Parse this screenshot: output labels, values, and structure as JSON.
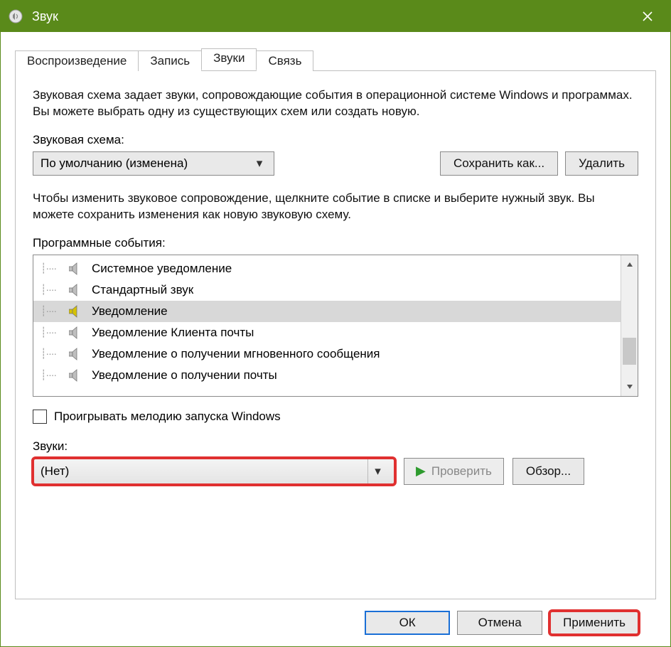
{
  "title": "Звук",
  "tabs": [
    "Воспроизведение",
    "Запись",
    "Звуки",
    "Связь"
  ],
  "active_tab": 2,
  "description": "Звуковая схема задает звуки, сопровождающие события в операционной системе Windows и программах. Вы можете выбрать одну из существующих схем или создать новую.",
  "scheme_label": "Звуковая схема:",
  "scheme_dropdown": "По умолчанию (изменена)",
  "save_as_btn": "Сохранить как...",
  "delete_btn": "Удалить",
  "events_desc": "Чтобы изменить звуковое сопровождение, щелкните событие в списке и выберите нужный звук. Вы можете сохранить изменения как новую звуковую схему.",
  "events_label": "Программные события:",
  "events": [
    {
      "label": "Системное уведомление",
      "has_sound": false,
      "selected": false
    },
    {
      "label": "Стандартный звук",
      "has_sound": false,
      "selected": false
    },
    {
      "label": "Уведомление",
      "has_sound": true,
      "selected": true
    },
    {
      "label": "Уведомление Клиента почты",
      "has_sound": false,
      "selected": false
    },
    {
      "label": "Уведомление о получении мгновенного сообщения",
      "has_sound": false,
      "selected": false
    },
    {
      "label": "Уведомление о получении почты",
      "has_sound": false,
      "selected": false
    }
  ],
  "play_startup_checkbox": "Проигрывать мелодию запуска Windows",
  "play_startup_checked": false,
  "sounds_label": "Звуки:",
  "sounds_dropdown": "(Нет)",
  "test_btn": "Проверить",
  "browse_btn": "Обзор...",
  "footer": {
    "ok": "ОК",
    "cancel": "Отмена",
    "apply": "Применить"
  }
}
